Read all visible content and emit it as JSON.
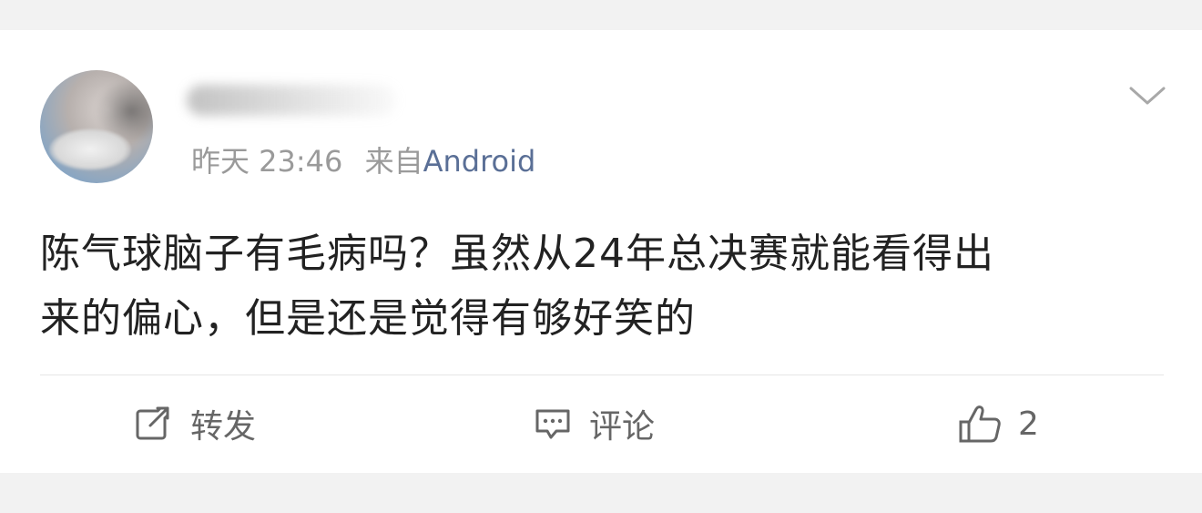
{
  "post": {
    "author": {
      "name": "",
      "avatar_icon": "avatar-icon"
    },
    "time": "昨天 23:46",
    "source_prefix": "来自",
    "source": "Android",
    "content_lines": [
      "陈气球脑子有毛病吗？虽然从24年总决赛就能看得出",
      "来的偏心，但是还是觉得有够好笑的"
    ],
    "menu_icon": "chevron-down-icon"
  },
  "actions": {
    "repost": {
      "label": "转发",
      "icon": "repost-icon"
    },
    "comment": {
      "label": "评论",
      "icon": "comment-icon"
    },
    "like": {
      "count": "2",
      "icon": "thumbs-up-icon"
    }
  },
  "colors": {
    "background": "#f2f2f2",
    "card": "#ffffff",
    "text": "#222222",
    "meta": "#9a9a9a",
    "source_link": "#5a6f96",
    "action": "#666666"
  }
}
